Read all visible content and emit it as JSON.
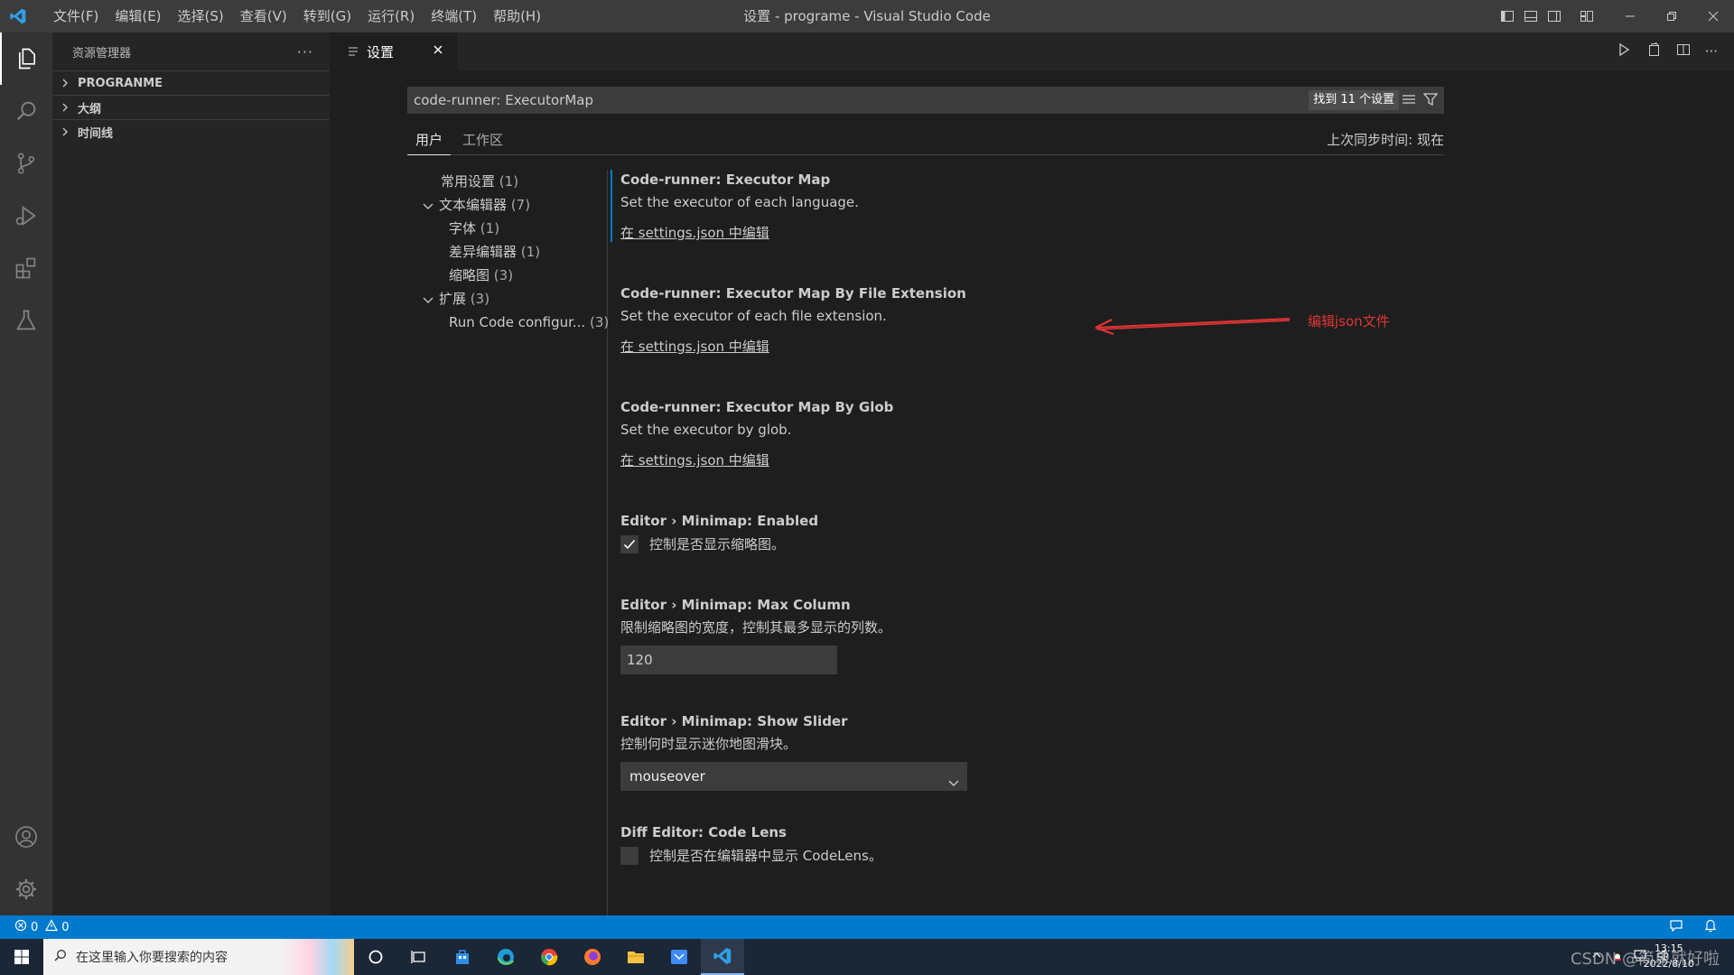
{
  "titlebar": {
    "menu": [
      "文件(F)",
      "编辑(E)",
      "选择(S)",
      "查看(V)",
      "转到(G)",
      "运行(R)",
      "终端(T)",
      "帮助(H)"
    ],
    "title": "设置 - programe - Visual Studio Code"
  },
  "sidebar": {
    "header": "资源管理器",
    "sections": [
      "PROGRANME",
      "大纲",
      "时间线"
    ]
  },
  "tab": {
    "label": "设置"
  },
  "search": {
    "value": "code-runner: ExecutorMap",
    "count": "找到 11 个设置"
  },
  "scope_tabs": {
    "user": "用户",
    "workspace": "工作区",
    "sync": "上次同步时间: 现在"
  },
  "toc": [
    {
      "label": "常用设置",
      "count": "(1)"
    },
    {
      "label": "文本编辑器",
      "count": "(7)"
    },
    {
      "label": "字体",
      "count": "(1)"
    },
    {
      "label": "差异编辑器",
      "count": "(1)"
    },
    {
      "label": "缩略图",
      "count": "(3)"
    },
    {
      "label": "扩展",
      "count": "(3)"
    },
    {
      "label": "Run Code configur...",
      "count": "(3)"
    }
  ],
  "settings": {
    "s1": {
      "category": "Code-runner: ",
      "name": "Executor Map",
      "desc": "Set the executor of each language.",
      "link": "在 settings.json 中编辑"
    },
    "s2": {
      "category": "Code-runner: ",
      "name": "Executor Map By File Extension",
      "desc": "Set the executor of each file extension.",
      "link": "在 settings.json 中编辑"
    },
    "s3": {
      "category": "Code-runner: ",
      "name": "Executor Map By Glob",
      "desc": "Set the executor by glob.",
      "link": "在 settings.json 中编辑"
    },
    "s4": {
      "category": "Editor › Minimap: ",
      "name": "Enabled",
      "desc": "控制是否显示缩略图。",
      "checked": true
    },
    "s5": {
      "category": "Editor › Minimap: ",
      "name": "Max Column",
      "desc": "限制缩略图的宽度，控制其最多显示的列数。",
      "value": "120"
    },
    "s6": {
      "category": "Editor › Minimap: ",
      "name": "Show Slider",
      "desc": "控制何时显示迷你地图滑块。",
      "value": "mouseover"
    },
    "s7": {
      "category": "Diff Editor: ",
      "name": "Code Lens",
      "desc": "控制是否在编辑器中显示 CodeLens。",
      "checked": false
    }
  },
  "annotation": {
    "text": "编辑json文件",
    "color": "#e03535"
  },
  "statusbar": {
    "errors": "0",
    "warnings": "0"
  },
  "taskbar": {
    "search_placeholder": "在这里输入你要搜索的内容",
    "clock_time": "13:15",
    "clock_date": "2022/8/10",
    "tray_text": "CSDN @简单就好啦"
  },
  "colors": {
    "accent": "#007acc",
    "activity_bar": "#333333",
    "sidebar": "#252526",
    "editor": "#1e1e1e"
  }
}
